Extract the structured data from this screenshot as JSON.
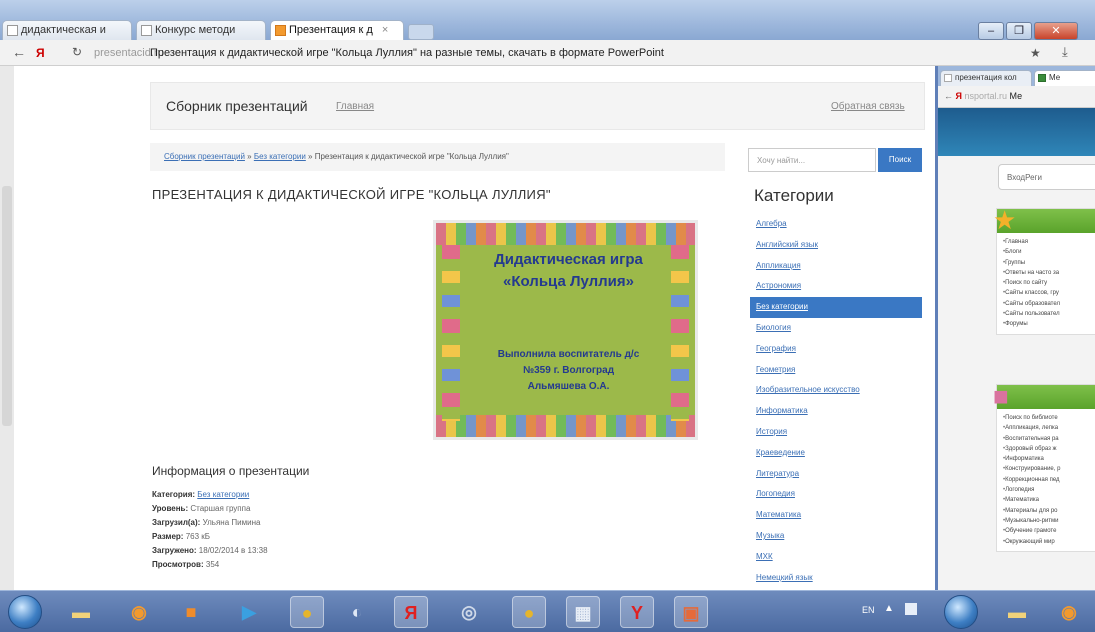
{
  "browser": {
    "tabs": [
      {
        "label": "дидактическая и",
        "active": false
      },
      {
        "label": "Конкурс методи",
        "active": false
      },
      {
        "label": "Презентация к д",
        "active": true
      }
    ],
    "url_host": "presentacid.ru",
    "url_title": "Презентация к дидактической игре \"Кольца Луллия\" на разные темы, скачать в формате PowerPoint"
  },
  "site": {
    "title": "Сборник презентаций",
    "home_link": "Главная",
    "feedback_link": "Обратная связь"
  },
  "breadcrumb": {
    "root": "Сборник презентаций",
    "category": "Без категории",
    "current": "Презентация к дидактической игре \"Кольца Луллия\"",
    "separator": "»"
  },
  "page_title": "ПРЕЗЕНТАЦИЯ К ДИДАКТИЧЕСКОЙ ИГРЕ \"КОЛЬЦА ЛУЛЛИЯ\"",
  "slide": {
    "title_line1": "Дидактическая игра",
    "title_line2": "«Кольца Луллия»",
    "author_line1": "Выполнила воспитатель д/с",
    "author_line2": "№359 г. Волгоград",
    "author_line3": "Альмяшева О.А."
  },
  "info": {
    "heading": "Информация о презентации",
    "category_label": "Категория:",
    "category_value": "Без категории",
    "level_label": "Уровень:",
    "level_value": "Старшая группа",
    "uploaded_by_label": "Загрузил(а):",
    "uploaded_by_value": "Ульяна Пимина",
    "size_label": "Размер:",
    "size_value": "763 кБ",
    "date_label": "Загружено:",
    "date_value": "18/02/2014 в 13:38",
    "views_label": "Просмотров:",
    "views_value": "354"
  },
  "search": {
    "placeholder": "Хочу найти...",
    "button": "Поиск"
  },
  "categories": {
    "title": "Категории",
    "items": [
      "Алгебра",
      "Английский язык",
      "Аппликация",
      "Астрономия",
      "Без категории",
      "Биология",
      "География",
      "Геометрия",
      "Изобразительное искусство",
      "Информатика",
      "История",
      "Краеведение",
      "Литература",
      "Логопедия",
      "Математика",
      "Музыка",
      "МХК",
      "Немецкий язык"
    ],
    "active_index": 4
  },
  "second_window": {
    "tabs": [
      "презентация кол",
      "Ме"
    ],
    "url_host": "nsportal.ru",
    "url_title": "Ме",
    "box_text": "ВходРеги",
    "panel1_items": [
      "Главная",
      "Блоги",
      "Группы",
      "Ответы на часто за",
      "Поиск по сайту",
      "Сайты классов, гру",
      "Сайты образовател",
      "Сайты пользовател",
      "Форумы"
    ],
    "panel2_items": [
      "Поиск по библиоте",
      "Аппликация, лепка",
      "Воспитательная ра",
      "Здоровый образ ж",
      "Информатика",
      "Конструирование, р",
      "Коррекционная пед",
      "Логопедия",
      "Математика",
      "Материалы для ро",
      "Музыкально-ритми",
      "Обучение грамоте",
      "Окружающий мир"
    ]
  },
  "taskbar": {
    "lang": "EN",
    "icons": [
      "folder-icon",
      "avast-icon",
      "orange-app-icon",
      "media-player-icon",
      "chrome-icon",
      "sound-icon",
      "yandex-icon",
      "search-app-icon",
      "chrome-icon",
      "calculator-icon",
      "yandex-browser-icon",
      "presentation-icon"
    ]
  }
}
